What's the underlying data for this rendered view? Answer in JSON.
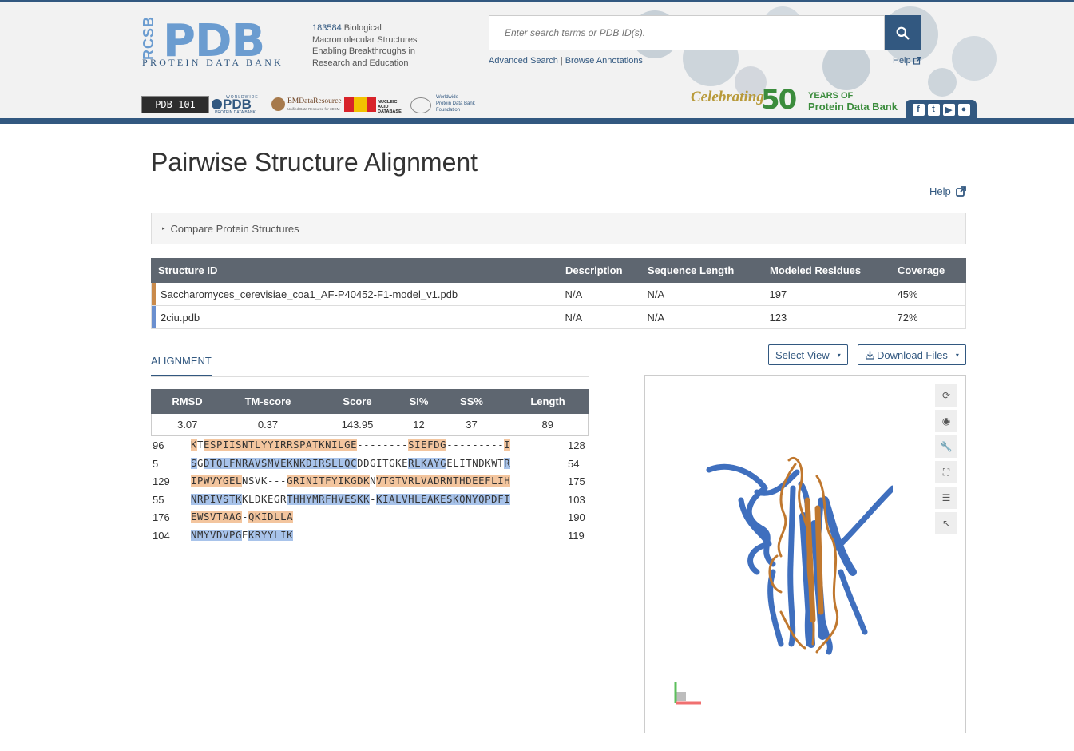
{
  "header": {
    "logo_side": "RCSB",
    "logo_main": "PDB",
    "logo_sub": "PROTEIN DATA BANK",
    "tagline_count": "183584",
    "tagline_text": " Biological Macromolecular Structures Enabling Breakthroughs in Research and Education",
    "search_placeholder": "Enter search terms or PDB ID(s).",
    "advanced_search": "Advanced Search",
    "link_separator": "|",
    "browse_annotations": "Browse Annotations",
    "help": "Help",
    "partners": {
      "pdb101": "PDB-101",
      "wwpdb_top": "WORLDWIDE",
      "wwpdb_main": "PDB",
      "wwpdb_sub": "PROTEIN DATA BANK",
      "emdr_main": "EMDataResource",
      "emdr_sub": "Unified Data Resource for 3DEM",
      "ndb_line1": "NUCLEIC ACID",
      "ndb_line2": "DATABASE",
      "wwpdbf_line1": "Worldwide",
      "wwpdbf_line2": "Protein Data Bank",
      "wwpdbf_line3": "Foundation"
    },
    "celebrating": "Celebrating",
    "fifty": "50",
    "years_of": "YEARS OF",
    "years_pdb": "Protein Data Bank",
    "social_icons": [
      "facebook-icon",
      "twitter-icon",
      "youtube-icon",
      "github-icon"
    ],
    "social_glyphs": {
      "facebook": "f",
      "twitter": "t",
      "youtube": "▶",
      "github": "●"
    }
  },
  "page": {
    "title": "Pairwise Structure Alignment",
    "help": "Help",
    "compare_panel": "Compare Protein Structures",
    "caret_glyph": "▸"
  },
  "structures": {
    "headers": [
      "Structure ID",
      "Description",
      "Sequence Length",
      "Modeled Residues",
      "Coverage"
    ],
    "rows": [
      {
        "id": "Saccharomyces_cerevisiae_coa1_AF-P40452-F1-model_v1.pdb",
        "description": "N/A",
        "seq_length": "N/A",
        "modeled": "197",
        "coverage": "45%",
        "color": "#c98a4b"
      },
      {
        "id": "2ciu.pdb",
        "description": "N/A",
        "seq_length": "N/A",
        "modeled": "123",
        "coverage": "72%",
        "color": "#6a8fcf"
      }
    ]
  },
  "tabs": {
    "alignment": "ALIGNMENT"
  },
  "controls": {
    "select_view": "Select View",
    "download_files": "Download Files",
    "caret": "▾"
  },
  "stats": {
    "headers": [
      "RMSD",
      "TM-score",
      "Score",
      "SI%",
      "SS%",
      "Length"
    ],
    "values": [
      "3.07",
      "0.37",
      "143.95",
      "12",
      "37",
      "89"
    ]
  },
  "alignment_rows": [
    {
      "start": "96",
      "end": "128",
      "chain": "a",
      "segments": [
        {
          "t": "K",
          "h": true
        },
        {
          "t": "T",
          "h": false
        },
        {
          "t": "ESPIISNTLYYIRRSPATKNILGE",
          "h": true
        },
        {
          "t": "--------",
          "h": false
        },
        {
          "t": "SIEFDG",
          "h": true
        },
        {
          "t": "---------",
          "h": false
        },
        {
          "t": "I",
          "h": true
        }
      ]
    },
    {
      "start": "5",
      "end": "54",
      "chain": "b",
      "segments": [
        {
          "t": "S",
          "h": true
        },
        {
          "t": "G",
          "h": false
        },
        {
          "t": "DTQLFNRAVSMVEKNKDIRSLLQC",
          "h": true
        },
        {
          "t": "DDGITGKE",
          "h": false
        },
        {
          "t": "RLKAYG",
          "h": true
        },
        {
          "t": "ELITNDKWT",
          "h": false
        },
        {
          "t": "R",
          "h": true
        }
      ]
    },
    {
      "start": "129",
      "end": "175",
      "chain": "a",
      "segments": [
        {
          "t": "IPWVYGEL",
          "h": true
        },
        {
          "t": "NSVK---",
          "h": false
        },
        {
          "t": "GRINITFYIKGDK",
          "h": true
        },
        {
          "t": "N",
          "h": false
        },
        {
          "t": "VTGTVRLVADRNTHDEEFLIH",
          "h": true
        }
      ]
    },
    {
      "start": "55",
      "end": "103",
      "chain": "b",
      "segments": [
        {
          "t": "NRPIVSTK",
          "h": true
        },
        {
          "t": "KLDKEGR",
          "h": false
        },
        {
          "t": "THHYMRFHVESKK",
          "h": true
        },
        {
          "t": "-",
          "h": false
        },
        {
          "t": "KIALVHLEAKESKQNYQPDFI",
          "h": true
        }
      ]
    },
    {
      "start": "176",
      "end": "190",
      "chain": "a",
      "segments": [
        {
          "t": "EWSVTAAG",
          "h": true
        },
        {
          "t": "-",
          "h": false
        },
        {
          "t": "QKIDLLA",
          "h": true
        }
      ]
    },
    {
      "start": "104",
      "end": "119",
      "chain": "b",
      "segments": [
        {
          "t": "NMYVDVPG",
          "h": true
        },
        {
          "t": "E",
          "h": false
        },
        {
          "t": "KRYYLIK",
          "h": true
        }
      ]
    }
  ],
  "viewer": {
    "tools": [
      "reset-view-icon",
      "screenshot-icon",
      "wrench-icon",
      "expand-icon",
      "sliders-icon",
      "pointer-icon"
    ],
    "tool_glyphs": [
      "⟳",
      "◉",
      "🔧",
      "⛶",
      "☰",
      "↖"
    ],
    "chain_colors": {
      "a": "#c0782f",
      "b": "#3f6fbe"
    }
  }
}
